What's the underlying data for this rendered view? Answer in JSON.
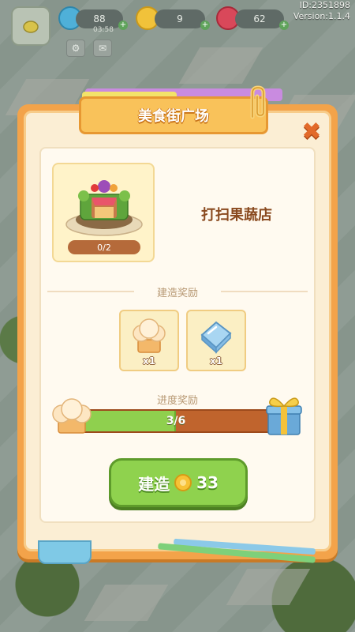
{
  "hud": {
    "gems": "88",
    "gems_sub": "03:58",
    "coins": "9",
    "rubies": "62",
    "user_id": "ID:2351898",
    "version": "Version:1.1.4"
  },
  "dialog": {
    "title": "美食街广场",
    "shop_task": "打扫果蔬店",
    "shop_progress": "0/2",
    "build_reward_title": "建造奖励",
    "rewards": [
      {
        "icon": "chef-hat-icon",
        "qty": "x1"
      },
      {
        "icon": "ice-block-icon",
        "qty": "x1"
      }
    ],
    "progress_reward_title": "进度奖励",
    "progress_text": "3/6",
    "progress_value": 0.5,
    "build_label": "建造",
    "build_cost": "33"
  },
  "colors": {
    "dialog_orange": "#f3a34a",
    "build_green": "#8fd24e",
    "title_text": "#8a4a1f"
  }
}
